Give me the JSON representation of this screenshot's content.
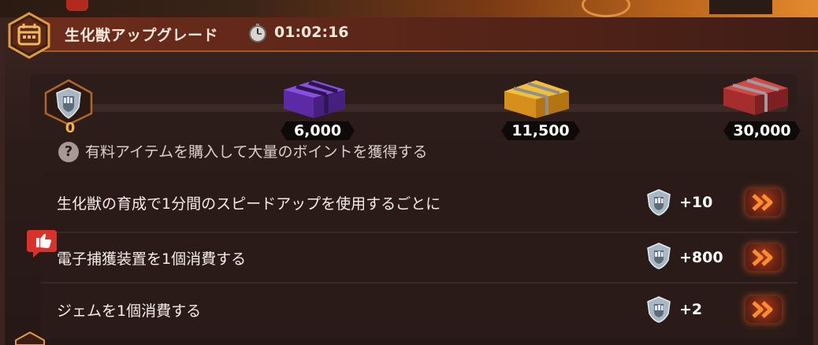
{
  "header": {
    "title": "生化獣アップグレード",
    "timer": "01:02:16"
  },
  "progress": {
    "current_points": "0",
    "milestones": [
      {
        "label": "6,000",
        "chest": "purple-chest-icon",
        "color": "#7b3fc9"
      },
      {
        "label": "11,500",
        "chest": "gold-chest-icon",
        "color": "#e0a22a"
      },
      {
        "label": "30,000",
        "chest": "red-chest-icon",
        "color": "#c23a3a"
      }
    ]
  },
  "tasks": [
    {
      "text": "有料アイテムを購入して大量のポイントを獲得する",
      "points": ""
    },
    {
      "text": "生化獣の育成で1分間のスピードアップを使用するごとに",
      "points": "+10"
    },
    {
      "text": "電子捕獲装置を1個消費する",
      "points": "+800"
    },
    {
      "text": "ジェムを1個消費する",
      "points": "+2"
    }
  ],
  "colors": {
    "accent": "#f5b13a",
    "button_glow": "#dc5a1e",
    "header_bg": "#6e2d1b"
  }
}
